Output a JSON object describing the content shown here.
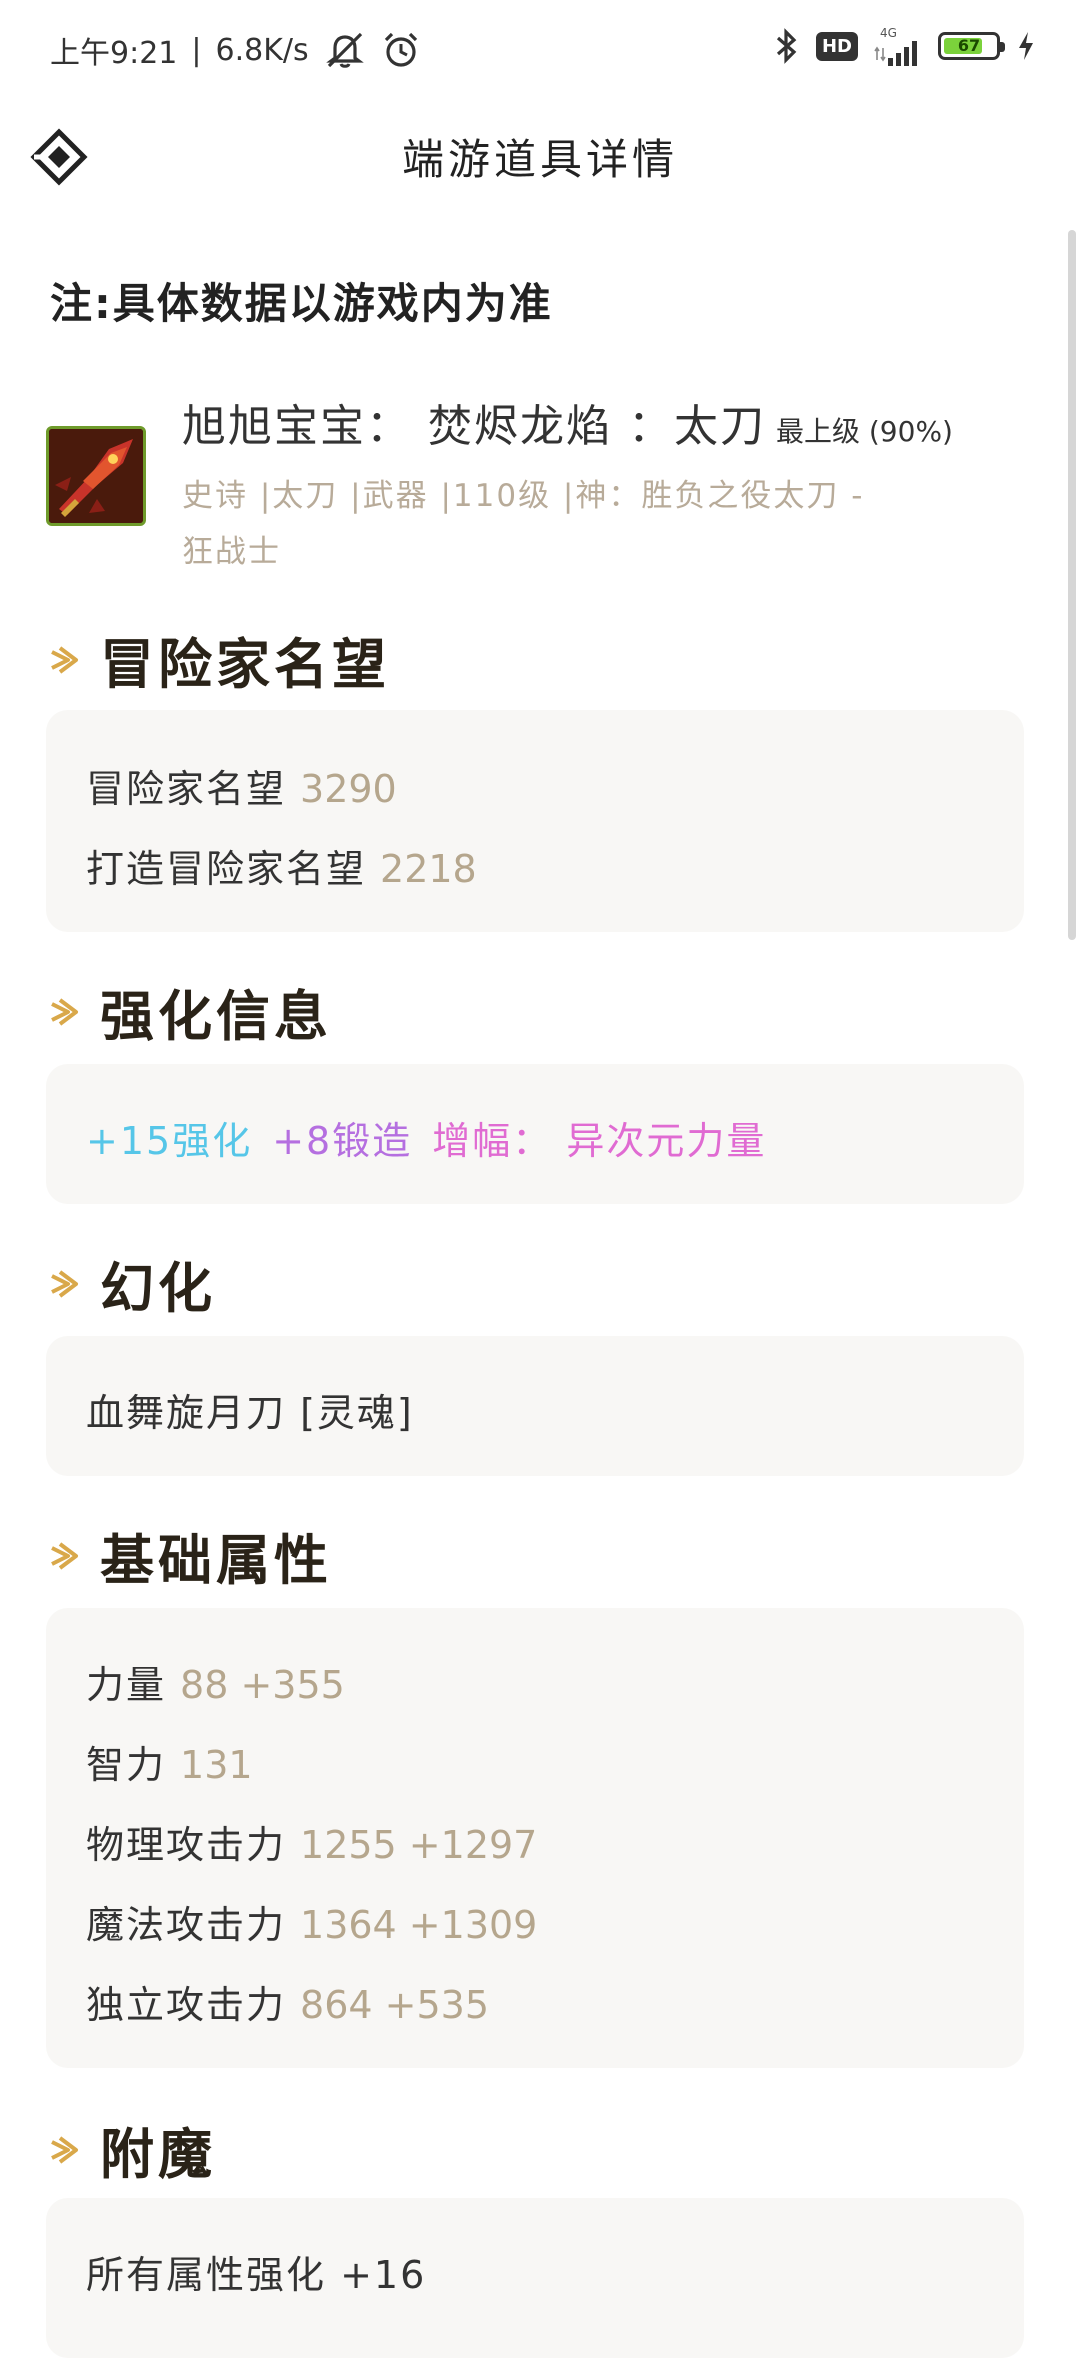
{
  "status_bar": {
    "time": "上午9:21",
    "net_speed": "6.8K/s",
    "hd": "HD",
    "network": "4G",
    "battery": "67"
  },
  "header": {
    "title": "端游道具详情"
  },
  "note": "注:具体数据以游戏内为准",
  "item": {
    "name": "旭旭宝宝： 焚烬龙焰 ：太刀",
    "grade": "最上级 (90%)",
    "meta": "史诗 |太刀 |武器 |110级 |神：胜负之役太刀 -",
    "meta2": "狂战士"
  },
  "sections": {
    "reputation": {
      "title": "冒险家名望",
      "rows": [
        {
          "label": "冒险家名望",
          "value": "3290"
        },
        {
          "label": "打造冒险家名望",
          "value": "2218"
        }
      ]
    },
    "enhance": {
      "title": "强化信息",
      "reinforce": "+15强化",
      "forge": "+8锻造",
      "amplify": "增幅： 异次元力量"
    },
    "transmog": {
      "title": "幻化",
      "value": "血舞旋月刀 [灵魂]"
    },
    "base_stats": {
      "title": "基础属性",
      "rows": [
        {
          "label": "力量",
          "value": "88 +355"
        },
        {
          "label": "智力",
          "value": "131"
        },
        {
          "label": "物理攻击力",
          "value": "1255 +1297"
        },
        {
          "label": "魔法攻击力",
          "value": "1364 +1309"
        },
        {
          "label": "独立攻击力",
          "value": "864 +535"
        }
      ]
    },
    "enchant": {
      "title": "附魔",
      "rows": [
        {
          "label": "所有属性强化 +16"
        }
      ]
    }
  },
  "colors": {
    "accent_arrow": "#d9a84a",
    "value_text": "#b5a68d",
    "enhance_blue": "#56c6e8",
    "forge_purple": "#b56fe0",
    "amplify_pink": "#e06bd2"
  }
}
